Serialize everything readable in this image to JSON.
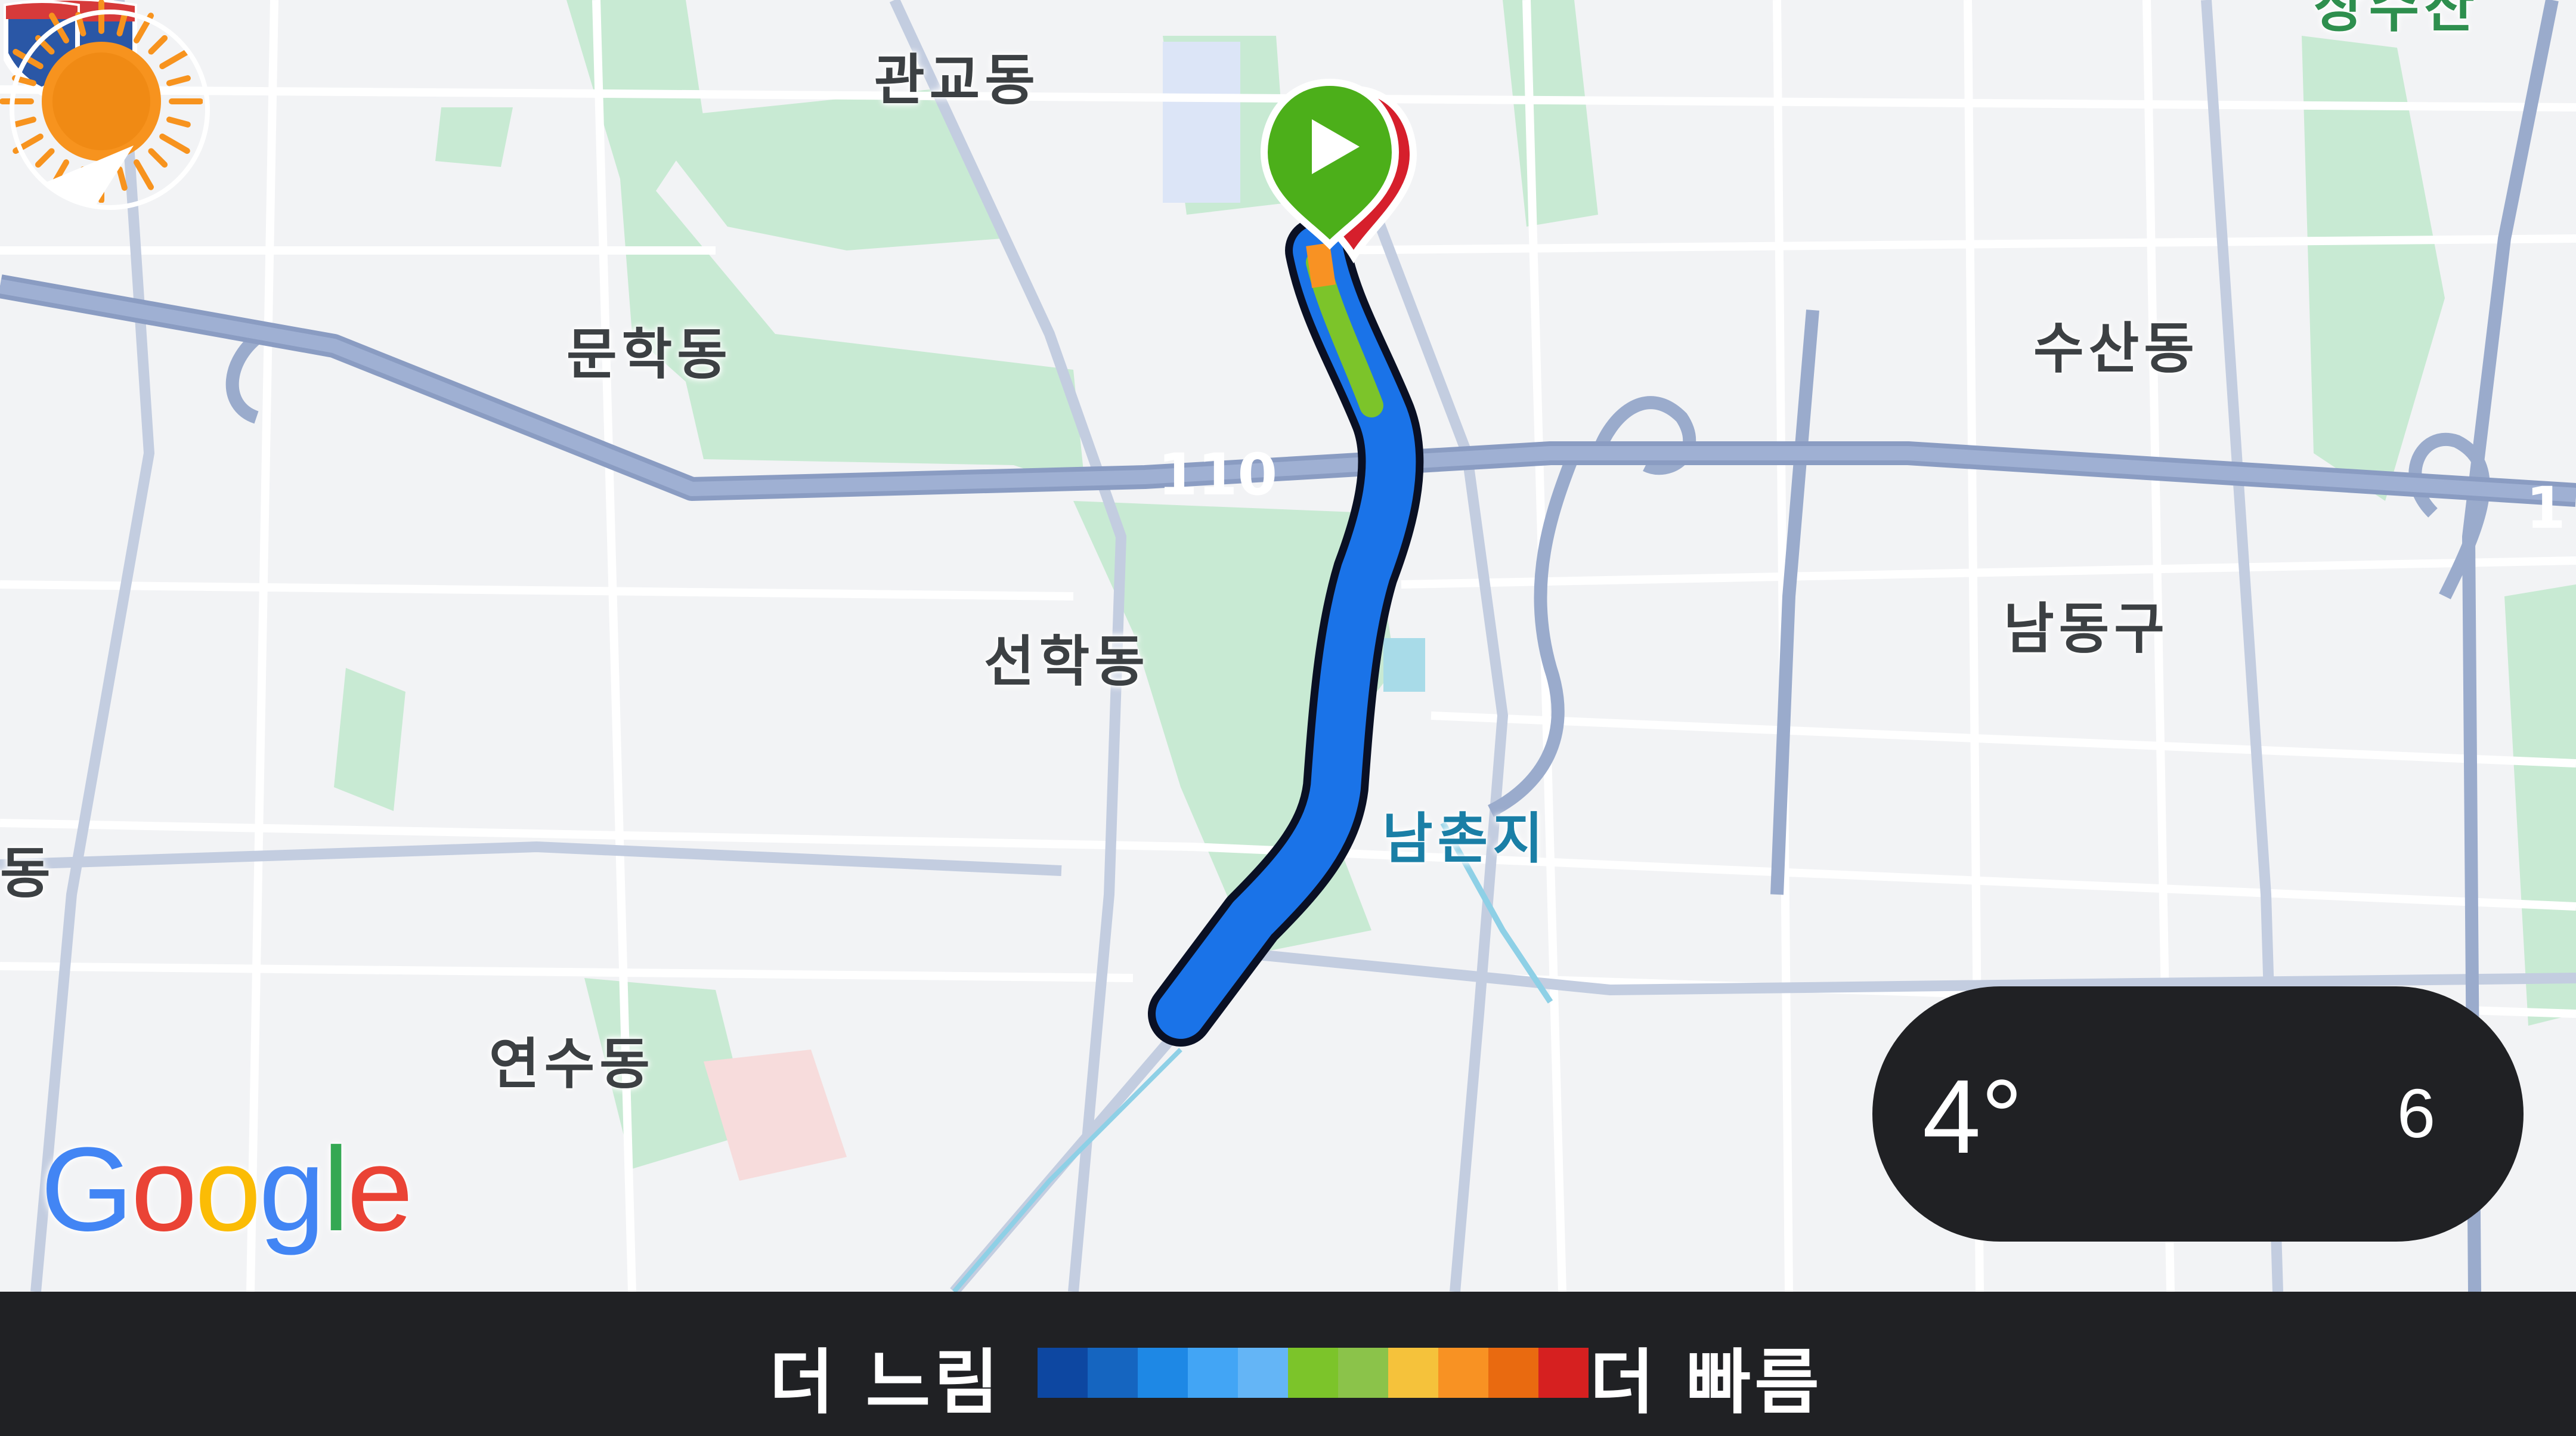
{
  "map": {
    "places": [
      {
        "id": "gwangyo",
        "label": "관교동"
      },
      {
        "id": "munhak",
        "label": "문학동"
      },
      {
        "id": "susan",
        "label": "수산동"
      },
      {
        "id": "seonhak",
        "label": "선학동"
      },
      {
        "id": "namdong",
        "label": "남동구"
      },
      {
        "id": "namchonji",
        "label": "남촌지"
      },
      {
        "id": "yeonsu",
        "label": "연수동"
      },
      {
        "id": "edge-dong",
        "label": "동"
      },
      {
        "id": "top-right-partial",
        "label": "상수산"
      }
    ],
    "highway_shield": {
      "label": "110"
    },
    "highway_shield_partial": {
      "label": "1"
    },
    "google_logo": {
      "letters": [
        "G",
        "o",
        "o",
        "g",
        "l",
        "e"
      ],
      "colors": [
        "#4285F4",
        "#EA4335",
        "#FBBC05",
        "#4285F4",
        "#34A853",
        "#EA4335"
      ]
    },
    "start_marker_icon": "play-icon",
    "end_marker_icon": "destination-pin-icon",
    "colors": {
      "park": "#c6ecd2",
      "road": "#ffffff",
      "major_road": "#aab8d4",
      "highway": "#8fa2c7",
      "route": "#1a73e8",
      "water": "#a8dbe8"
    }
  },
  "weather": {
    "temperature": "4°",
    "condition_icon": "sun-icon",
    "aqi_value": "6",
    "aqi_fraction": 0.06
  },
  "legend": {
    "slower_label": "더 느림",
    "faster_label": "더 빠름",
    "swatches": [
      "#0d47a1",
      "#1565c0",
      "#1e88e5",
      "#42a5f5",
      "#64b5f6",
      "#7cc42a",
      "#8bc34a",
      "#f5c23b",
      "#f89223",
      "#e96a10",
      "#d62020"
    ]
  }
}
